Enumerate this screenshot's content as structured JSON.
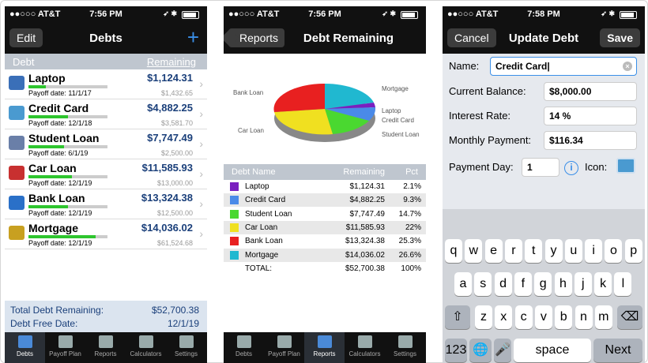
{
  "status": [
    {
      "carrier": "●●○○○ AT&T",
      "time": "7:56 PM"
    },
    {
      "carrier": "●●○○○ AT&T",
      "time": "7:56 PM"
    },
    {
      "carrier": "●●○○○ AT&T",
      "time": "7:58 PM"
    }
  ],
  "debts_screen": {
    "edit": "Edit",
    "title": "Debts",
    "add": "+",
    "col_debt": "Debt",
    "col_remaining": "Remaining",
    "rows": [
      {
        "name": "Laptop",
        "amount": "$1,124.31",
        "payoff": "Payoff date: 11/1/17",
        "original": "$1,432.65",
        "progress": 0.22,
        "icon": "laptop-icon",
        "color": "#3a6fb8"
      },
      {
        "name": "Credit Card",
        "amount": "$4,882.25",
        "payoff": "Payoff date: 12/1/18",
        "original": "$3,581.70",
        "progress": 0.5,
        "icon": "credit-card-icon",
        "color": "#4a9ad0"
      },
      {
        "name": "Student Loan",
        "amount": "$7,747.49",
        "payoff": "Payoff date: 6/1/19",
        "original": "$2,500.00",
        "progress": 0.45,
        "icon": "student-icon",
        "color": "#6a7fa8"
      },
      {
        "name": "Car Loan",
        "amount": "$11,585.93",
        "payoff": "Payoff date: 12/1/19",
        "original": "$13,000.00",
        "progress": 0.55,
        "icon": "car-icon",
        "color": "#c83030"
      },
      {
        "name": "Bank Loan",
        "amount": "$13,324.38",
        "payoff": "Payoff date: 12/1/19",
        "original": "$12,500.00",
        "progress": 0.5,
        "icon": "bank-icon",
        "color": "#2a70c8"
      },
      {
        "name": "Mortgage",
        "amount": "$14,036.02",
        "payoff": "Payoff date: 12/1/19",
        "original": "$61,524.68",
        "progress": 0.85,
        "icon": "money-icon",
        "color": "#c8a020"
      }
    ],
    "total_label": "Total Debt Remaining:",
    "total_value": "$52,700.38",
    "free_label": "Debt Free Date:",
    "free_value": "12/1/19"
  },
  "tabs": [
    "Debts",
    "Payoff Plan",
    "Reports",
    "Calculators",
    "Settings"
  ],
  "reports_screen": {
    "back": "Reports",
    "title": "Debt Remaining",
    "pie_labels": [
      "Bank Loan",
      "Mortgage",
      "Car Loan",
      "Laptop",
      "Credit Card",
      "Student Loan"
    ],
    "col_name": "Debt Name",
    "col_remaining": "Remaining",
    "col_pct": "Pct",
    "rows": [
      {
        "name": "Laptop",
        "value": "$1,124.31",
        "pct": "2.1%",
        "color": "#7a1fbf"
      },
      {
        "name": "Credit Card",
        "value": "$4,882.25",
        "pct": "9.3%",
        "color": "#4a8ae8"
      },
      {
        "name": "Student Loan",
        "value": "$7,747.49",
        "pct": "14.7%",
        "color": "#4ad830"
      },
      {
        "name": "Car Loan",
        "value": "$11,585.93",
        "pct": "22%",
        "color": "#f0e020"
      },
      {
        "name": "Bank Loan",
        "value": "$13,324.38",
        "pct": "25.3%",
        "color": "#e82020"
      },
      {
        "name": "Mortgage",
        "value": "$14,036.02",
        "pct": "26.6%",
        "color": "#20b8d0"
      },
      {
        "name": "TOTAL:",
        "value": "$52,700.38",
        "pct": "100%",
        "color": ""
      }
    ]
  },
  "update_screen": {
    "cancel": "Cancel",
    "title": "Update Debt",
    "save": "Save",
    "name_label": "Name:",
    "name_value": "Credit Card",
    "balance_label": "Current Balance:",
    "balance_value": "$8,000.00",
    "rate_label": "Interest Rate:",
    "rate_value": "14 %",
    "payment_label": "Monthly Payment:",
    "payment_value": "$116.34",
    "day_label": "Payment Day:",
    "day_value": "1",
    "icon_label": "Icon:",
    "keys_row1": [
      "q",
      "w",
      "e",
      "r",
      "t",
      "y",
      "u",
      "i",
      "o",
      "p"
    ],
    "keys_row2": [
      "a",
      "s",
      "d",
      "f",
      "g",
      "h",
      "j",
      "k",
      "l"
    ],
    "keys_row3": [
      "z",
      "x",
      "c",
      "v",
      "b",
      "n",
      "m"
    ],
    "key_123": "123",
    "key_space": "space",
    "key_next": "Next",
    "key_shift": "⇧",
    "key_del": "⌫",
    "key_globe": "🌐",
    "key_mic": "🎤"
  }
}
